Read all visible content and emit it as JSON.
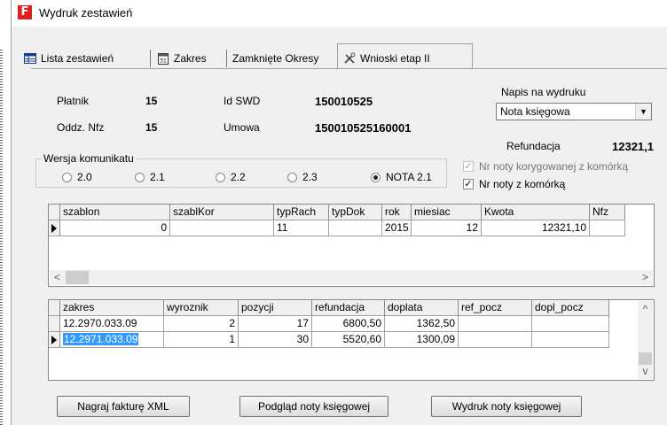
{
  "window": {
    "title": "Wydruk zestawień",
    "app_icon": "F"
  },
  "tabs": [
    {
      "label": "Lista zestawień",
      "icon": "table-icon"
    },
    {
      "label": "Zakres",
      "icon": "calendar-icon"
    },
    {
      "label": "Zamknięte Okresy",
      "icon": null
    },
    {
      "label": "Wnioski etap II",
      "icon": "tools-icon",
      "active": true
    }
  ],
  "info": {
    "platnik_label": "Płatnik",
    "platnik_value": "15",
    "oddz_label": "Oddz. Nfz",
    "oddz_value": "15",
    "idswd_label": "Id SWD",
    "idswd_value": "150010525",
    "umowa_label": "Umowa",
    "umowa_value": "150010525160001"
  },
  "napis": {
    "label": "Napis na wydruku",
    "selected": "Nota księgowa"
  },
  "refundacja": {
    "label": "Refundacja",
    "value": "12321,1"
  },
  "checks": {
    "korygowanej": {
      "label": "Nr noty korygowanej z komórką",
      "checked": true,
      "disabled": true
    },
    "noty": {
      "label": "Nr noty z komórką",
      "checked": true,
      "disabled": false
    }
  },
  "wersja": {
    "legend": "Wersja komunikatu",
    "options": [
      {
        "label": "2.0",
        "selected": false
      },
      {
        "label": "2.1",
        "selected": false
      },
      {
        "label": "2.2",
        "selected": false
      },
      {
        "label": "2.3",
        "selected": false
      },
      {
        "label": "NOTA 2.1",
        "selected": true
      }
    ]
  },
  "grid1": {
    "columns": [
      "szablon",
      "szablKor",
      "typRach",
      "typDok",
      "rok",
      "miesiac",
      "Kwota",
      "Nfz"
    ],
    "rows": [
      [
        "0",
        "",
        "11",
        "",
        "2015",
        "12",
        "12321,10",
        ""
      ]
    ]
  },
  "grid2": {
    "columns": [
      "zakres",
      "wyroznik",
      "pozycji",
      "refundacja",
      "doplata",
      "ref_pocz",
      "dopl_pocz"
    ],
    "rows": [
      [
        "12.2970.033.09",
        "2",
        "17",
        "6800,50",
        "1362,50",
        "",
        ""
      ],
      [
        "12.2971.033.09",
        "1",
        "30",
        "5520,60",
        "1300,09",
        "",
        ""
      ]
    ]
  },
  "buttons": {
    "nagraj": "Nagraj fakturę XML",
    "podglad": "Podgląd noty księgowej",
    "wydruk": "Wydruk noty księgowej"
  }
}
